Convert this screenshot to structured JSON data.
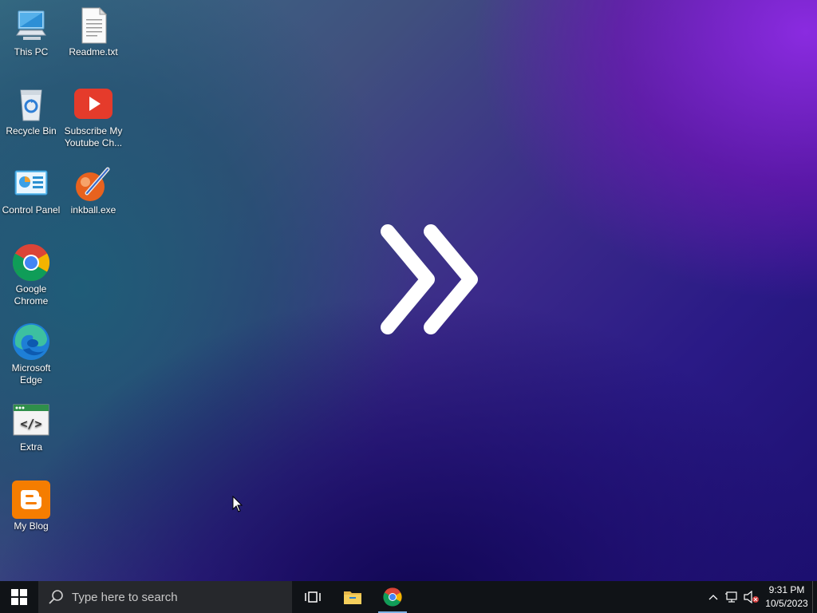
{
  "desktop": {
    "icons": [
      {
        "label": "This PC",
        "icon": "this-pc-icon"
      },
      {
        "label": "Readme.txt",
        "icon": "text-file-icon"
      },
      {
        "label": "Recycle Bin",
        "icon": "recycle-bin-icon"
      },
      {
        "label": "Subscribe My Youtube Ch...",
        "icon": "youtube-icon"
      },
      {
        "label": "Control Panel",
        "icon": "control-panel-icon"
      },
      {
        "label": "inkball.exe",
        "icon": "inkball-icon"
      },
      {
        "label": "Google Chrome",
        "icon": "chrome-icon"
      },
      {
        "label": "Microsoft Edge",
        "icon": "edge-icon"
      },
      {
        "label": "Extra",
        "icon": "code-window-icon"
      },
      {
        "label": "My Blog",
        "icon": "blogger-icon"
      }
    ],
    "wallpaper_logo": "double-chevron-icon"
  },
  "taskbar": {
    "start_icon": "windows-logo-icon",
    "search_placeholder": "Type here to search",
    "pinned": [
      {
        "name": "Task View",
        "icon": "task-view-icon"
      },
      {
        "name": "File Explorer",
        "icon": "file-explorer-icon"
      },
      {
        "name": "Google Chrome",
        "icon": "chrome-icon"
      }
    ],
    "tray": {
      "time": "9:31 PM",
      "date": "10/5/2023"
    }
  },
  "colors": {
    "taskbar_bg": "#101317",
    "search_bg": "#26282c",
    "accent": "#7fb2e5"
  }
}
